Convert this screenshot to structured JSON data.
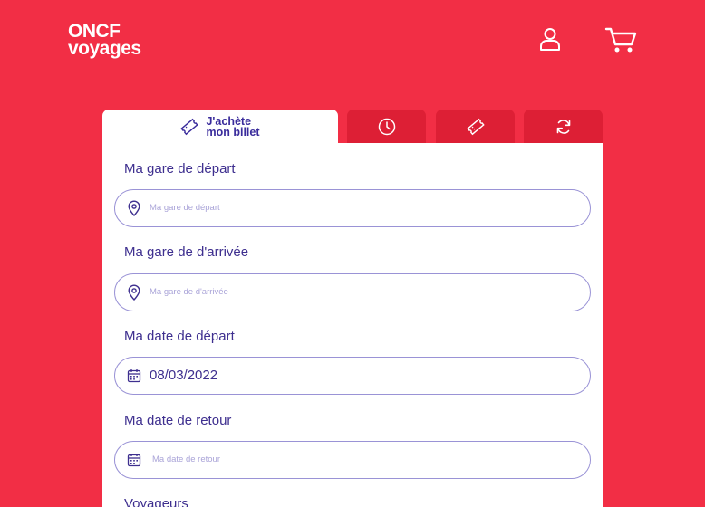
{
  "header": {
    "logo_line1": "ONCF",
    "logo_line2": "voyages",
    "account_icon": "user-icon",
    "cart_icon": "cart-icon"
  },
  "tabs": [
    {
      "label": "J'achète\nmon billet",
      "icon": "ticket-icon",
      "active": true
    },
    {
      "label": "",
      "icon": "clock-icon",
      "active": false
    },
    {
      "label": "",
      "icon": "ticket-icon",
      "active": false
    },
    {
      "label": "",
      "icon": "refresh-icon",
      "active": false
    }
  ],
  "form": {
    "departure": {
      "label": "Ma gare de départ",
      "placeholder": "Ma gare de départ",
      "icon": "location-pin-icon"
    },
    "arrival": {
      "label": "Ma gare de d'arrivée",
      "placeholder": "Ma gare de d'arrivée",
      "icon": "location-pin-icon"
    },
    "departure_date": {
      "label": "Ma date de départ",
      "value": "08/03/2022",
      "icon": "calendar-icon"
    },
    "return_date": {
      "label": "Ma date de retour",
      "placeholder": "Ma date de retour",
      "icon": "calendar-icon"
    },
    "travelers": {
      "label": "Voyageurs"
    }
  },
  "colors": {
    "brand_red": "#f22e45",
    "tab_inactive": "#dd1f35",
    "text_purple": "#3e2f8f",
    "field_border": "#9a93d6",
    "placeholder": "#aaa4d8"
  }
}
